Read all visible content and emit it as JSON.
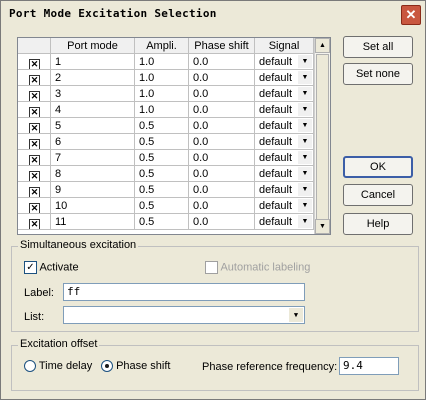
{
  "window": {
    "title": "Port Mode Excitation Selection",
    "close_label": "✕"
  },
  "table": {
    "headers": [
      "",
      "Port mode",
      "Ampli.",
      "Phase shift",
      "Signal"
    ],
    "rows": [
      {
        "check": "✕",
        "mode": "1",
        "ampli": "1.0",
        "phase": "0.0",
        "signal": "default"
      },
      {
        "check": "✕",
        "mode": "2",
        "ampli": "1.0",
        "phase": "0.0",
        "signal": "default"
      },
      {
        "check": "✕",
        "mode": "3",
        "ampli": "1.0",
        "phase": "0.0",
        "signal": "default"
      },
      {
        "check": "✕",
        "mode": "4",
        "ampli": "1.0",
        "phase": "0.0",
        "signal": "default"
      },
      {
        "check": "✕",
        "mode": "5",
        "ampli": "0.5",
        "phase": "0.0",
        "signal": "default"
      },
      {
        "check": "✕",
        "mode": "6",
        "ampli": "0.5",
        "phase": "0.0",
        "signal": "default"
      },
      {
        "check": "✕",
        "mode": "7",
        "ampli": "0.5",
        "phase": "0.0",
        "signal": "default"
      },
      {
        "check": "✕",
        "mode": "8",
        "ampli": "0.5",
        "phase": "0.0",
        "signal": "default"
      },
      {
        "check": "✕",
        "mode": "9",
        "ampli": "0.5",
        "phase": "0.0",
        "signal": "default"
      },
      {
        "check": "✕",
        "mode": "10",
        "ampli": "0.5",
        "phase": "0.0",
        "signal": "default"
      },
      {
        "check": "✕",
        "mode": "11",
        "ampli": "0.5",
        "phase": "0.0",
        "signal": "default"
      }
    ]
  },
  "buttons": {
    "set_all": "Set all",
    "set_none": "Set none",
    "ok": "OK",
    "cancel": "Cancel",
    "help": "Help"
  },
  "simultaneous": {
    "legend": "Simultaneous excitation",
    "activate_label": "Activate",
    "activate_checked": "✓",
    "auto_label": "Automatic labeling",
    "label_caption": "Label:",
    "label_value": "ff",
    "list_caption": "List:",
    "list_value": ""
  },
  "offset": {
    "legend": "Excitation offset",
    "time_delay_label": "Time delay",
    "phase_shift_label": "Phase shift",
    "ref_freq_label": "Phase reference frequency:",
    "ref_freq_value": "9.4"
  }
}
